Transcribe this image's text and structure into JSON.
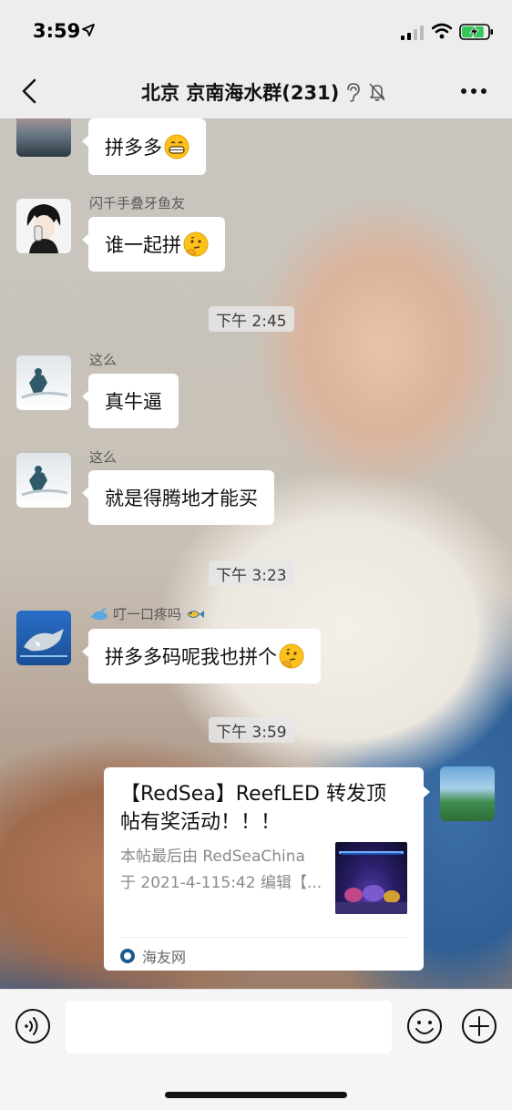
{
  "status_bar": {
    "time": "3:59",
    "battery_level": 0.85
  },
  "nav": {
    "title": "北京 京南海水群(231)",
    "back_icon": "chevron-left-icon",
    "ear_icon": "earpiece-icon",
    "mute_icon": "bell-slash-icon",
    "more_icon": "ellipsis-icon"
  },
  "messages": [
    {
      "sender": "",
      "text": "拼多多",
      "emoji": "grinning-face"
    },
    {
      "sender": "闪千手叠牙鱼友",
      "text": "谁一起拼",
      "emoji": "thinking-face"
    },
    {
      "time": "下午 2:45"
    },
    {
      "sender": "这么",
      "text": "真牛逼"
    },
    {
      "sender": "这么",
      "text": "就是得腾地才能买"
    },
    {
      "time": "下午 3:23"
    },
    {
      "sender": "叮一口疼吗",
      "text": "拼多多码呢我也拼个",
      "emoji": "thinking-face"
    },
    {
      "time": "下午 3:59"
    }
  ],
  "link_card": {
    "title": "【RedSea】ReefLED 转发顶帖有奖活动！！！",
    "description": "本帖最后由 RedSeaChina 于 2021-4-115:42 编辑【...",
    "source": "海友网"
  },
  "input_bar": {
    "placeholder": "",
    "voice_icon": "voice-icon",
    "emoji_icon": "smiley-icon",
    "plus_icon": "plus-circle-icon"
  }
}
